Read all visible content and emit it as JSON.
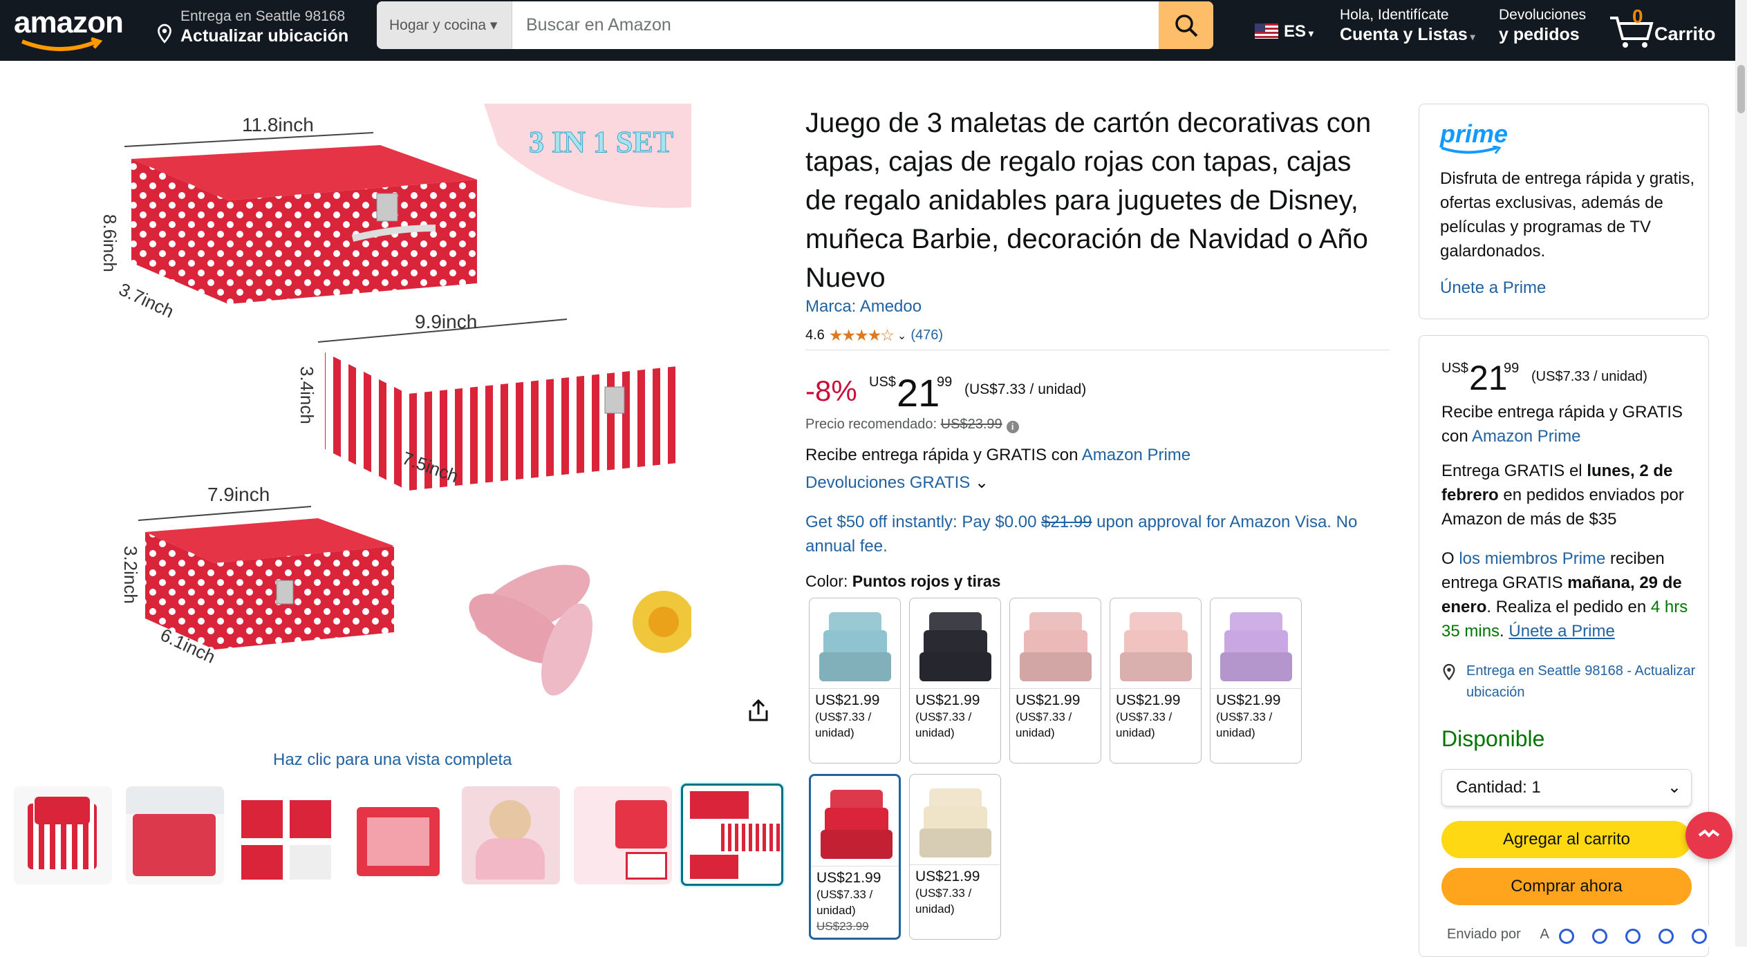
{
  "header": {
    "logo": "amazon",
    "location_line1": "Entrega en Seattle 98168",
    "location_line2": "Actualizar ubicación",
    "search_category": "Hogar y cocina",
    "search_placeholder": "Buscar en Amazon",
    "language": "ES",
    "account_line1": "Hola, Identifícate",
    "account_line2": "Cuenta y Listas",
    "returns_line1": "Devoluciones",
    "returns_line2": "y pedidos",
    "cart_count": "0",
    "cart_label": "Carrito"
  },
  "gallery": {
    "set_label": "3 IN 1 SET",
    "dims": {
      "big_w": "11.8inch",
      "big_h": "8.6inch",
      "big_d": "3.7inch",
      "mid_w": "9.9inch",
      "mid_h": "3.4inch",
      "mid_d": "7.5inch",
      "small_w": "7.9inch",
      "small_h": "3.2inch",
      "small_d": "6.1inch"
    },
    "view_full": "Haz clic para una vista completa"
  },
  "product": {
    "title": "Juego de 3 maletas de cartón decorativas con tapas, cajas de regalo rojas con tapas, cajas de regalo anidables para juguetes de Disney, muñeca Barbie, decoración de Navidad o Año Nuevo",
    "brand": "Marca: Amedoo",
    "rating": "4.6",
    "stars": "★★★★☆",
    "reviews": "(476)",
    "discount": "-8%",
    "currency": "US$",
    "price_whole": "21",
    "price_fraction": "99",
    "unit_price": "(US$7.33 / unidad)",
    "list_label": "Precio recomendado:",
    "list_price": "US$23.99",
    "delivery_text": "Recibe entrega rápida y GRATIS con ",
    "delivery_link": "Amazon Prime",
    "returns": "Devoluciones GRATIS",
    "promo_pre": "Get $50 off instantly: Pay $0.00 ",
    "promo_strike": "$21.99",
    "promo_post": " upon approval for Amazon Visa. No annual fee.",
    "color_label": "Color: ",
    "color_value": "Puntos rojos y tiras"
  },
  "swatches": [
    {
      "price": "US$21.99",
      "unit": "(US$7.33 / unidad)",
      "old": "",
      "color": "#8fc3cf"
    },
    {
      "price": "US$21.99",
      "unit": "(US$7.33 / unidad)",
      "old": "",
      "color": "#2a2a33"
    },
    {
      "price": "US$21.99",
      "unit": "(US$7.33 / unidad)",
      "old": "",
      "color": "#eab9b8"
    },
    {
      "price": "US$21.99",
      "unit": "(US$7.33 / unidad)",
      "old": "",
      "color": "#f1c3c0"
    },
    {
      "price": "US$21.99",
      "unit": "(US$7.33 / unidad)",
      "old": "",
      "color": "#c9a7e3"
    },
    {
      "price": "US$21.99",
      "unit": "(US$7.33 / unidad)",
      "old": "US$23.99",
      "color": "#d9243a"
    },
    {
      "price": "US$21.99",
      "unit": "(US$7.33 / unidad)",
      "old": "",
      "color": "#efe3c8"
    }
  ],
  "prime_box": {
    "logo": "prime",
    "desc": "Disfruta de entrega rápida y gratis, ofertas exclusivas, además de películas y programas de TV galardonados.",
    "join": "Únete a Prime"
  },
  "buy_box": {
    "currency": "US$",
    "price_whole": "21",
    "price_fraction": "99",
    "unit_price": "(US$7.33 / unidad)",
    "fast_pre": "Recibe entrega rápida y GRATIS con ",
    "fast_link": "Amazon Prime",
    "free_pre": "Entrega GRATIS el ",
    "free_date": "lunes, 2 de febrero",
    "free_post": " en pedidos enviados por Amazon de más de $35",
    "or": "O ",
    "members_link": "los miembros Prime",
    "members_mid": " reciben entrega GRATIS ",
    "members_date": "mañana, 29 de enero",
    "members_post": ". Realiza el pedido en ",
    "countdown": "4 hrs 35 mins",
    "join_link": "Únete a Prime",
    "location": "Entrega en Seattle 98168 - Actualizar ubicación",
    "availability": "Disponible",
    "quantity": "Cantidad:  1",
    "add_to_cart": "Agregar al carrito",
    "buy_now": "Comprar ahora",
    "sent_by": "Enviado por",
    "sent_by_value": "A"
  },
  "colors": {
    "header_bg": "#131921",
    "search_btn": "#febd69",
    "link": "#2162a1",
    "deal_red": "#cc0c39",
    "star": "#de7921",
    "available": "#007600",
    "cart_btn": "#ffd814",
    "buy_btn": "#ffa41c",
    "prime_blue": "#1399ff"
  }
}
